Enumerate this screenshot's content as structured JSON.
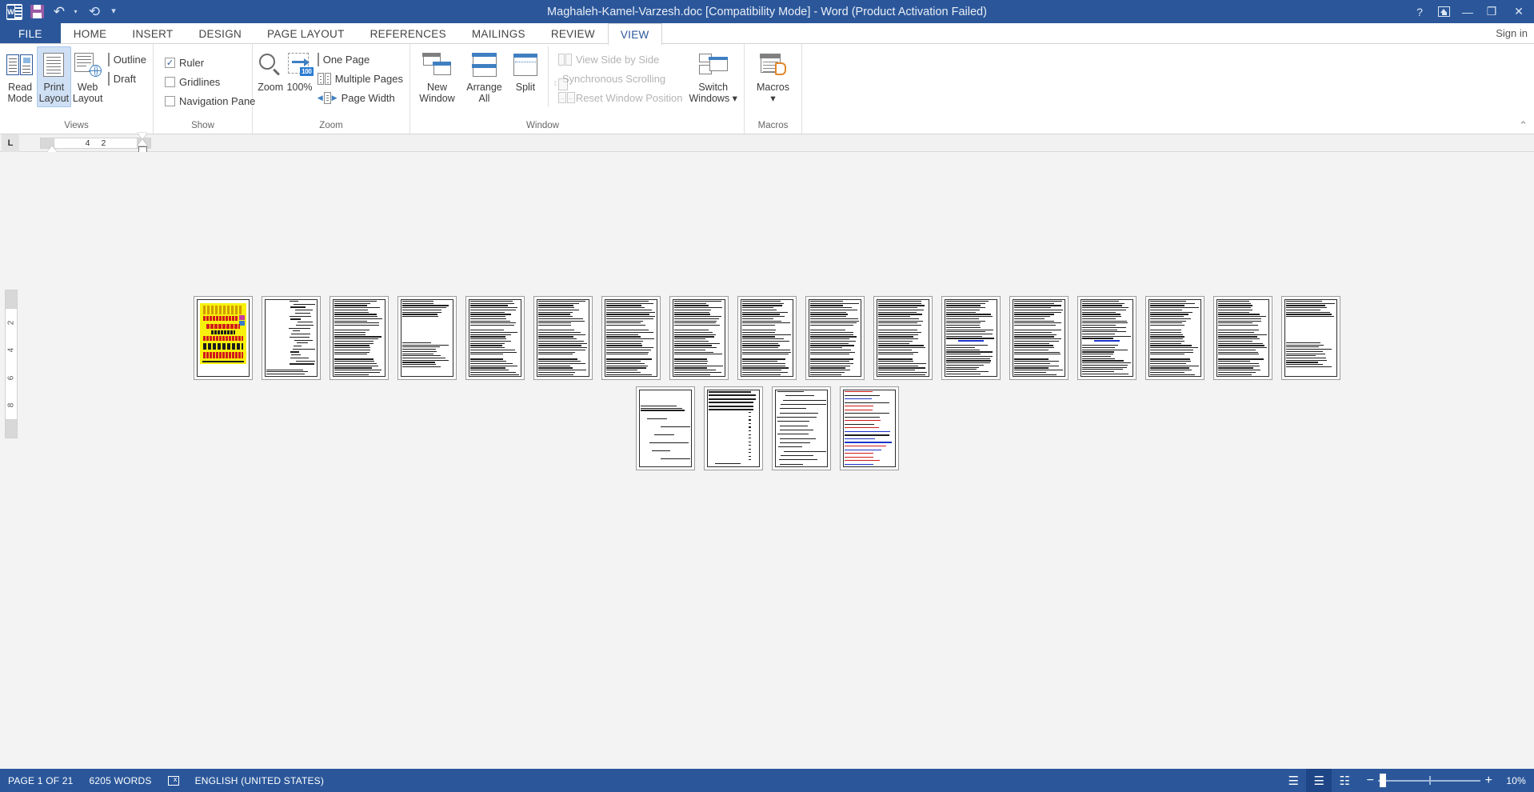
{
  "titlebar": {
    "document_title": "Maghaleh-Kamel-Varzesh.doc [Compatibility Mode] - Word (Product Activation Failed)",
    "quick_access": [
      {
        "name": "word-logo",
        "label": "W"
      },
      {
        "name": "save-icon",
        "label": "Save"
      },
      {
        "name": "undo-icon",
        "label": "Undo"
      },
      {
        "name": "redo-icon",
        "label": "Redo"
      },
      {
        "name": "customize-qat-icon",
        "label": "Customize Quick Access Toolbar"
      }
    ],
    "help_glyph": "?",
    "ribbon_display_label": "Ribbon Display Options",
    "minimize_glyph": "—",
    "restore_glyph": "❐",
    "close_glyph": "✕"
  },
  "tabs": [
    {
      "label": "FILE",
      "active": false,
      "file": true
    },
    {
      "label": "HOME",
      "active": false
    },
    {
      "label": "INSERT",
      "active": false
    },
    {
      "label": "DESIGN",
      "active": false
    },
    {
      "label": "PAGE LAYOUT",
      "active": false
    },
    {
      "label": "REFERENCES",
      "active": false
    },
    {
      "label": "MAILINGS",
      "active": false
    },
    {
      "label": "REVIEW",
      "active": false
    },
    {
      "label": "VIEW",
      "active": true
    }
  ],
  "signin_label": "Sign in",
  "ribbon": {
    "collapse_glyph": "⌃",
    "groups": [
      {
        "name": "views",
        "label": "Views",
        "big_buttons": [
          {
            "name": "read-mode",
            "line1": "Read",
            "line2": "Mode",
            "selected": false
          },
          {
            "name": "print-layout",
            "line1": "Print",
            "line2": "Layout",
            "selected": true
          },
          {
            "name": "web-layout",
            "line1": "Web",
            "line2": "Layout",
            "selected": false
          }
        ],
        "small_items": [
          {
            "name": "outline",
            "label": "Outline"
          },
          {
            "name": "draft",
            "label": "Draft"
          }
        ]
      },
      {
        "name": "show",
        "label": "Show",
        "checkboxes": [
          {
            "name": "ruler",
            "label": "Ruler",
            "checked": true
          },
          {
            "name": "gridlines",
            "label": "Gridlines",
            "checked": false
          },
          {
            "name": "navigation-pane",
            "label": "Navigation Pane",
            "checked": false
          }
        ]
      },
      {
        "name": "zoom",
        "label": "Zoom",
        "big_buttons": [
          {
            "name": "zoom",
            "line1": "Zoom",
            "line2": ""
          },
          {
            "name": "zoom-100",
            "line1": "100%",
            "line2": ""
          }
        ],
        "small_items": [
          {
            "name": "one-page",
            "label": "One Page"
          },
          {
            "name": "multiple-pages",
            "label": "Multiple Pages"
          },
          {
            "name": "page-width",
            "label": "Page Width"
          }
        ]
      },
      {
        "name": "window",
        "label": "Window",
        "big_buttons": [
          {
            "name": "new-window",
            "line1": "New",
            "line2": "Window"
          },
          {
            "name": "arrange-all",
            "line1": "Arrange",
            "line2": "All"
          },
          {
            "name": "split",
            "line1": "Split",
            "line2": ""
          },
          {
            "name": "switch-windows",
            "line1": "Switch",
            "line2": "Windows ▾"
          }
        ],
        "small_items": [
          {
            "name": "view-side-by-side",
            "label": "View Side by Side",
            "disabled": true
          },
          {
            "name": "synchronous-scrolling",
            "label": "Synchronous Scrolling",
            "disabled": true
          },
          {
            "name": "reset-window-position",
            "label": "Reset Window Position",
            "disabled": true
          }
        ]
      },
      {
        "name": "macros",
        "label": "Macros",
        "big_buttons": [
          {
            "name": "macros",
            "line1": "Macros",
            "line2": "▾"
          }
        ]
      }
    ]
  },
  "ruler": {
    "tab_stop_glyph": "L",
    "marks": [
      "4",
      "2"
    ]
  },
  "vertical_ruler": {
    "marks": [
      "2",
      "4",
      "6",
      "8"
    ]
  },
  "document": {
    "page_count_visible": 21,
    "rows": [
      {
        "pages": [
          {
            "id": 1,
            "kind": "ad",
            "ad_lines": 7
          },
          {
            "id": 2,
            "kind": "toc"
          },
          {
            "id": 3,
            "kind": "text-dense"
          },
          {
            "id": 4,
            "kind": "text-sparse"
          },
          {
            "id": 5,
            "kind": "text-dense"
          },
          {
            "id": 6,
            "kind": "text-dense"
          },
          {
            "id": 7,
            "kind": "text-dense"
          },
          {
            "id": 8,
            "kind": "text-dense"
          },
          {
            "id": 9,
            "kind": "text-dense"
          },
          {
            "id": 10,
            "kind": "text-dense"
          },
          {
            "id": 11,
            "kind": "text-dense"
          },
          {
            "id": 12,
            "kind": "text-link"
          },
          {
            "id": 13,
            "kind": "text-dense"
          },
          {
            "id": 14,
            "kind": "text-link"
          },
          {
            "id": 15,
            "kind": "text-dense"
          },
          {
            "id": 16,
            "kind": "text-dense"
          },
          {
            "id": 17,
            "kind": "text-sparse"
          }
        ]
      },
      {
        "pages": [
          {
            "id": 18,
            "kind": "conclusion"
          },
          {
            "id": 19,
            "kind": "heavy-head"
          },
          {
            "id": 20,
            "kind": "list"
          },
          {
            "id": 21,
            "kind": "references"
          }
        ]
      }
    ]
  },
  "statusbar": {
    "page_indicator": "PAGE 1 OF 21",
    "word_count": "6205 WORDS",
    "proofing_icon_name": "proofing-errors-icon",
    "language": "ENGLISH (UNITED STATES)",
    "view_buttons": [
      {
        "name": "read-mode-view",
        "glyph": "☰",
        "active": false
      },
      {
        "name": "print-layout-view",
        "glyph": "☰",
        "active": true
      },
      {
        "name": "web-layout-view",
        "glyph": "☷",
        "active": false
      }
    ],
    "zoom_out_glyph": "−",
    "zoom_in_glyph": "+",
    "zoom_percent": "10%",
    "zoom_value": 10
  },
  "colors": {
    "brand": "#2b579a",
    "accent": "#3f7fc1",
    "selected_button": "#cfe0f5",
    "canvas": "#f3f3f3"
  }
}
